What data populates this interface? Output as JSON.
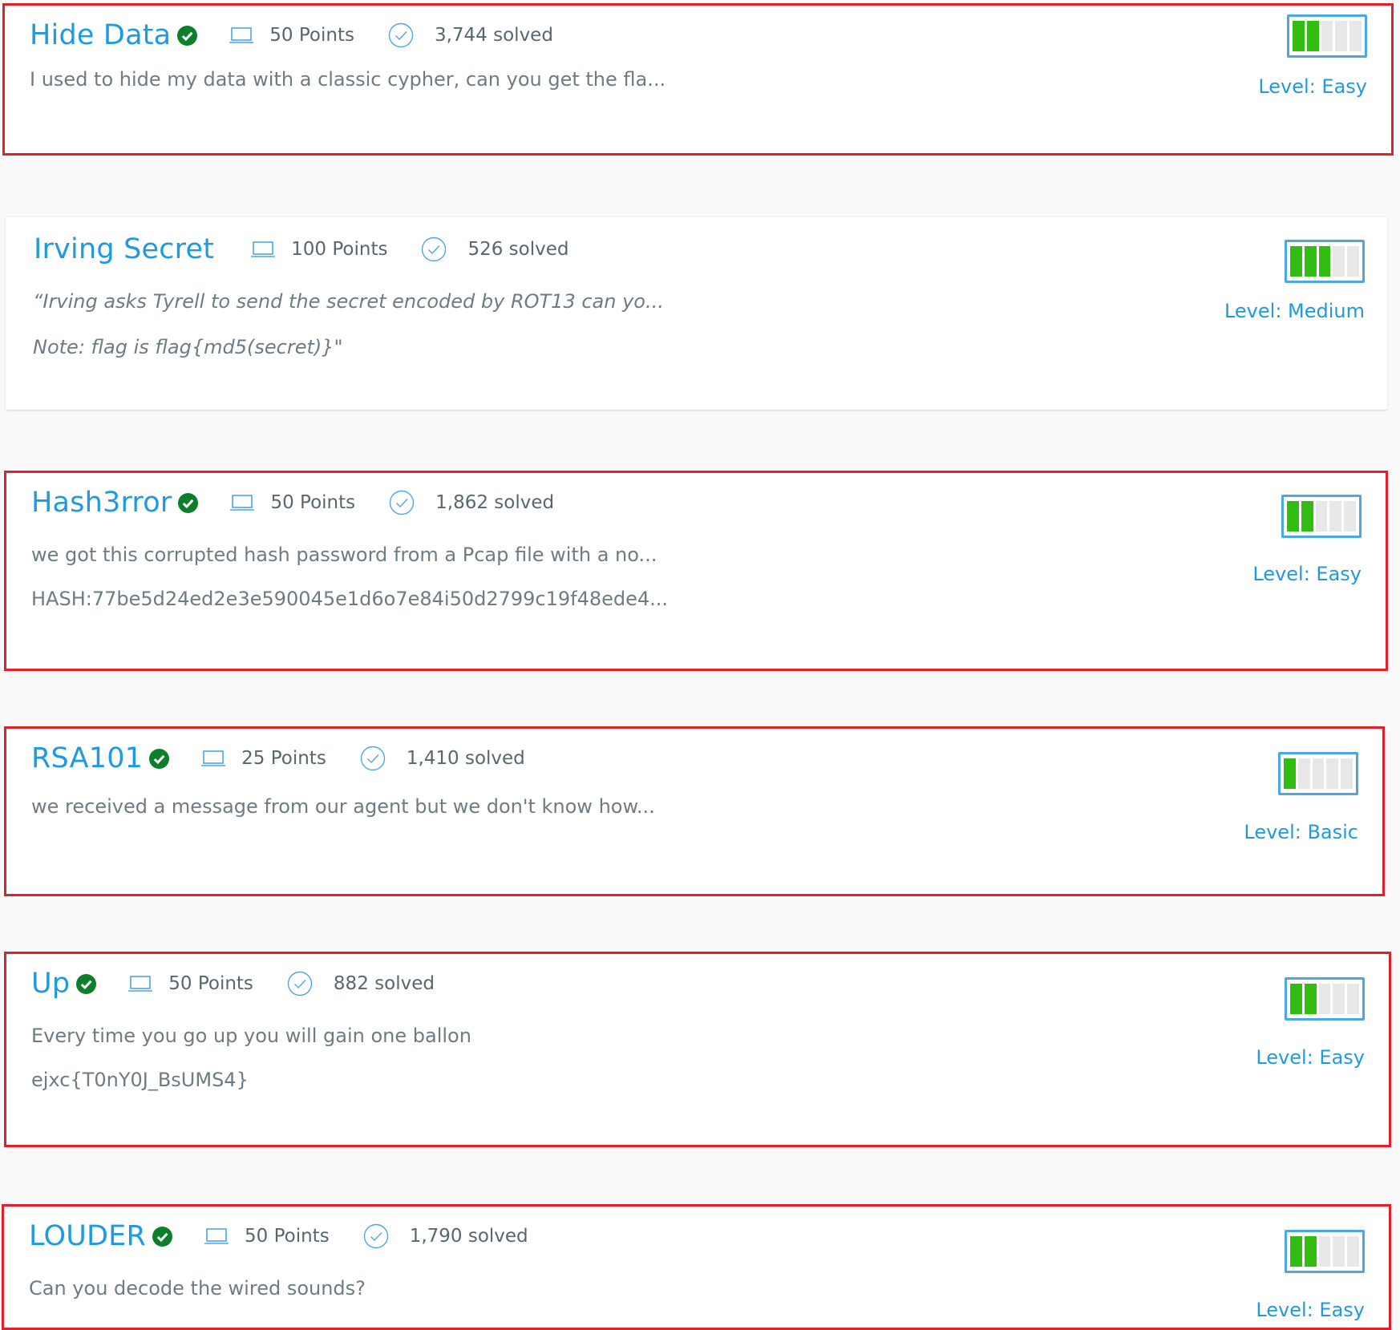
{
  "challenges": [
    {
      "title": "Hide Data",
      "solved_by_user": true,
      "points": "50 Points",
      "solved": "3,744 solved",
      "lines": [
        "I used to hide my data with a classic cypher, can you get the fla..."
      ],
      "italic": false,
      "level": "Level: Easy",
      "difficulty_fill": 0.4,
      "highlighted": true
    },
    {
      "title": "Irving Secret",
      "solved_by_user": false,
      "points": "100 Points",
      "solved": "526 solved",
      "lines": [
        "“Irving asks Tyrell to send the secret encoded by ROT13 can yo...",
        "Note: flag is flag{md5(secret)}\""
      ],
      "italic": true,
      "level": "Level: Medium",
      "difficulty_fill": 0.6,
      "highlighted": false
    },
    {
      "title": "Hash3rror",
      "solved_by_user": true,
      "points": "50 Points",
      "solved": "1,862 solved",
      "lines": [
        "we got this corrupted hash password from a Pcap file with a no...",
        "HASH:77be5d24ed2e3e590045e1d6o7e84i50d2799c19f48ede4..."
      ],
      "italic": false,
      "level": "Level: Easy",
      "difficulty_fill": 0.4,
      "highlighted": true
    },
    {
      "title": "RSA101",
      "solved_by_user": true,
      "points": "25 Points",
      "solved": "1,410 solved",
      "lines": [
        "we received a message from our agent but we don't know how..."
      ],
      "italic": false,
      "level": "Level: Basic",
      "difficulty_fill": 0.2,
      "highlighted": true
    },
    {
      "title": "Up",
      "solved_by_user": true,
      "points": "50 Points",
      "solved": "882 solved",
      "lines": [
        "Every time you go up you will gain one ballon",
        "ejxc{T0nY0J_BsUMS4}"
      ],
      "italic": false,
      "level": "Level: Easy",
      "difficulty_fill": 0.4,
      "highlighted": true
    },
    {
      "title": "LOUDER",
      "solved_by_user": true,
      "points": "50 Points",
      "solved": "1,790 solved",
      "lines": [
        "Can you decode the wired sounds?"
      ],
      "italic": false,
      "level": "Level: Easy",
      "difficulty_fill": 0.4,
      "highlighted": true
    }
  ],
  "colors": {
    "accent": "#1f9ae0",
    "highlight_border": "#e21f2b",
    "solved_check": "#0c7f2b",
    "difficulty_on": "#31bd11",
    "difficulty_off": "#e8e8e8"
  }
}
